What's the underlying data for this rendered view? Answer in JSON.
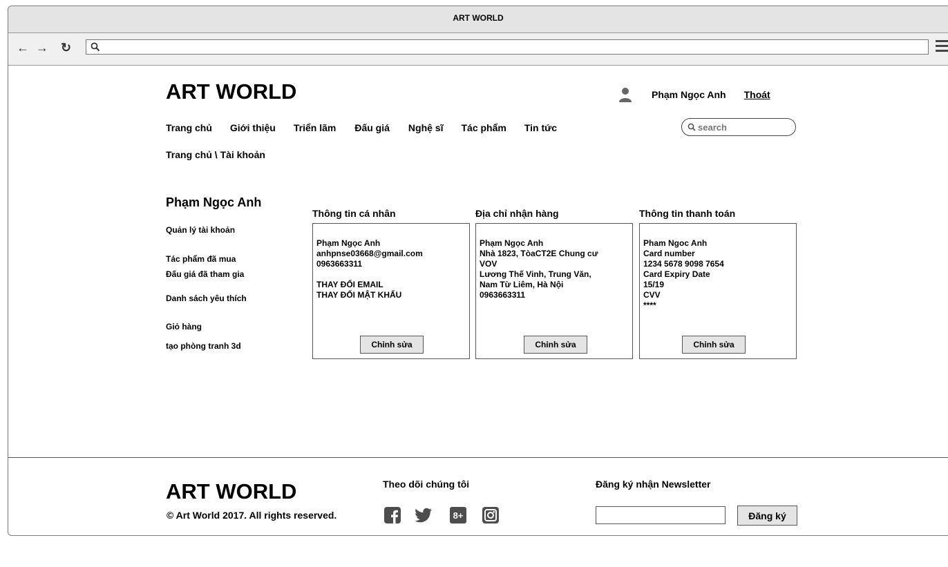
{
  "window": {
    "title": "ART WORLD"
  },
  "browser": {
    "url": ""
  },
  "header": {
    "logo": "ART WORLD",
    "user_name": "Phạm Ngọc Anh",
    "logout": "Thoát",
    "search_placeholder": "search"
  },
  "nav": {
    "items": [
      "Trang chủ",
      "Giới thiệu",
      "Triển lãm",
      "Đấu giá",
      "Nghệ sĩ",
      "Tác phẩm",
      "Tin tức"
    ]
  },
  "breadcrumb": "Trang chủ \\ Tài khoản",
  "sidebar": {
    "name": "Phạm Ngọc Anh",
    "items": [
      "Quản lý tài khoản",
      "Tác phẩm đã mua",
      "Đấu giá đã tham gia",
      "Danh sách yêu thích",
      "Giỏ hàng",
      "tạo phòng tranh 3d"
    ]
  },
  "panels": {
    "personal": {
      "title": "Thông tin cá nhân",
      "name": "Phạm Ngọc Anh",
      "email": "anhpnse03668@gmail.com",
      "phone": "0963663311",
      "change_email": "THAY ĐỔI EMAIL",
      "change_password": "THAY ĐỔI MẬT KHẨU",
      "edit": "Chỉnh sửa"
    },
    "address": {
      "title": "Địa chỉ nhận hàng",
      "name": "Phạm Ngọc Anh",
      "line1": "Nhà 1823, TòaCT2E Chung cư",
      "line2": "VOV",
      "line3": "Lương Thế Vinh, Trung Văn,",
      "line4": "Nam Từ Liêm, Hà Nội",
      "phone": "0963663311",
      "edit": "Chỉnh sửa"
    },
    "payment": {
      "title": "Thông tin thanh toán",
      "name": "Pham Ngoc Anh",
      "card_label": "Card number",
      "card_number": "1234 5678 9098 7654",
      "expiry_label": "Card Expiry Date",
      "expiry": "15/19",
      "cvv_label": "CVV",
      "cvv": "****",
      "edit": "Chỉnh sửa"
    }
  },
  "footer": {
    "logo": "ART WORLD",
    "copyright": "© Art World 2017. All rights reserved.",
    "follow_title": "Theo dõi chúng tôi",
    "social": [
      "facebook-icon",
      "twitter-icon",
      "google-plus-icon",
      "instagram-icon"
    ],
    "google_plus_glyph": "8+",
    "newsletter_title": "Đăng ký nhận Newsletter",
    "subscribe": "Đăng ký"
  }
}
